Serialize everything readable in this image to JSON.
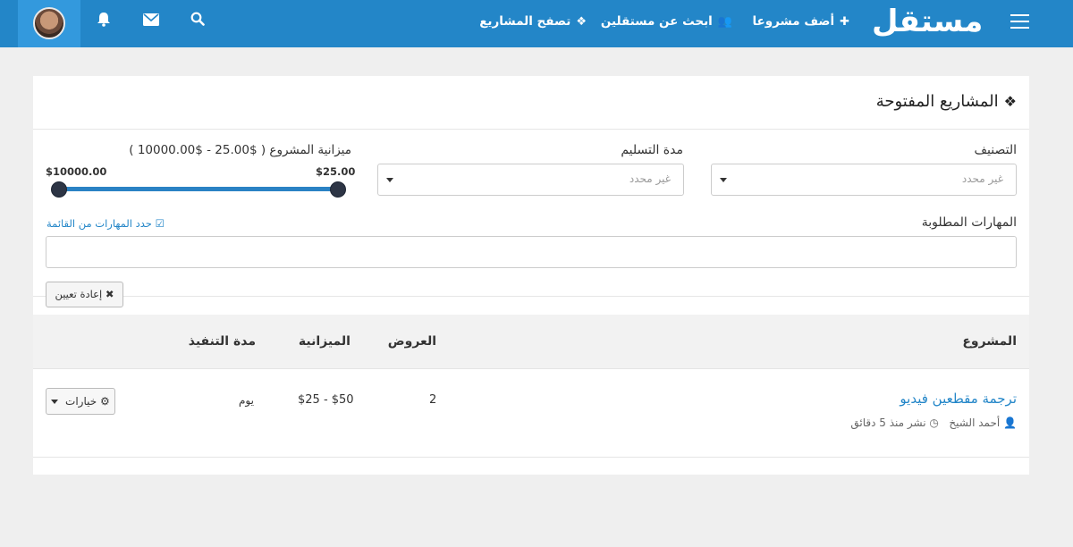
{
  "brand": {
    "logo_text": "مستقل",
    "primary_color": "#2386c8"
  },
  "nav": {
    "items": [
      {
        "label": "أضف مشروعا",
        "icon": "plus-icon"
      },
      {
        "label": "ابحث عن مستقلين",
        "icon": "users-icon"
      },
      {
        "label": "تصفح المشاريع",
        "icon": "cubes-icon"
      }
    ],
    "icons": [
      "search-icon",
      "envelope-icon",
      "bell-icon"
    ]
  },
  "panel": {
    "title": "المشاريع المفتوحة",
    "filters": {
      "category_label": "التصنيف",
      "category_value": "غير محدد",
      "delivery_label": "مدة التسليم",
      "delivery_value": "غير محدد",
      "budget_label": "ميزانية المشروع ( $25.00 - $10000.00 )",
      "budget_min": "$25.00",
      "budget_max": "$10000.00",
      "skills_label": "المهارات المطلوبة",
      "skills_link": "حدد المهارات من القائمة",
      "skills_value": "",
      "reset_label": "إعادة تعيين"
    }
  },
  "table": {
    "headers": {
      "project": "المشروع",
      "offers": "العروض",
      "budget": "الميزانية",
      "duration": "مدة التنفيذ"
    },
    "rows": [
      {
        "title": "ترجمة مقطعين فيديو",
        "author": "أحمد الشيخ",
        "posted": "نشر منذ 5 دقائق",
        "offers": "2",
        "budget": "$25 - $50",
        "duration": "يوم",
        "options_label": "خيارات"
      }
    ]
  }
}
